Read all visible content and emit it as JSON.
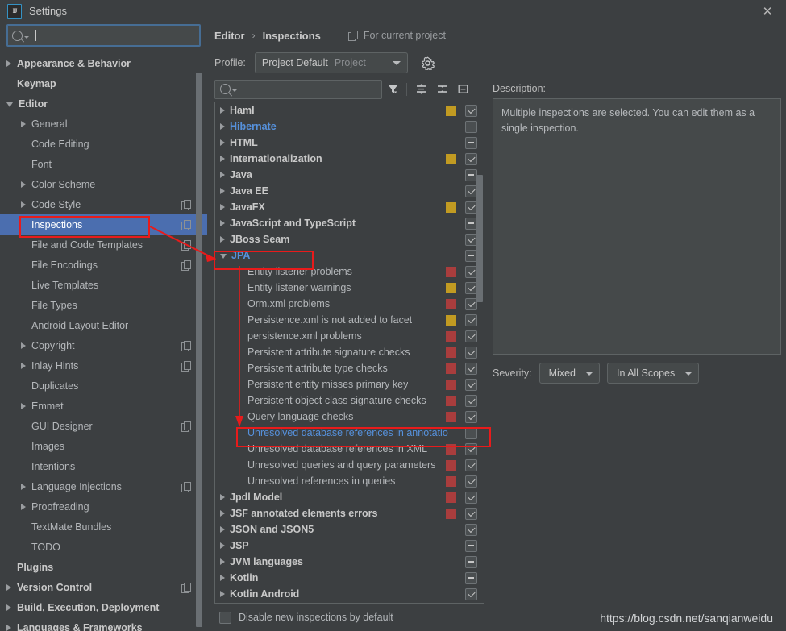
{
  "window": {
    "title": "Settings",
    "app_icon": "intellij-logo-icon",
    "close_icon": "close-icon"
  },
  "sidebar": {
    "search": {
      "value": "",
      "placeholder": "",
      "icon": "search-icon"
    },
    "items": [
      {
        "label": "Appearance & Behavior",
        "arrow": "right",
        "indent": 0,
        "bold": true,
        "copy": false,
        "selected": false
      },
      {
        "label": "Keymap",
        "arrow": "none",
        "indent": 0,
        "bold": true,
        "copy": false,
        "selected": false
      },
      {
        "label": "Editor",
        "arrow": "down",
        "indent": 0,
        "bold": true,
        "copy": false,
        "selected": false
      },
      {
        "label": "General",
        "arrow": "right",
        "indent": 1,
        "bold": false,
        "copy": false,
        "selected": false
      },
      {
        "label": "Code Editing",
        "arrow": "none",
        "indent": 1,
        "bold": false,
        "copy": false,
        "selected": false
      },
      {
        "label": "Font",
        "arrow": "none",
        "indent": 1,
        "bold": false,
        "copy": false,
        "selected": false
      },
      {
        "label": "Color Scheme",
        "arrow": "right",
        "indent": 1,
        "bold": false,
        "copy": false,
        "selected": false
      },
      {
        "label": "Code Style",
        "arrow": "right",
        "indent": 1,
        "bold": false,
        "copy": true,
        "selected": false
      },
      {
        "label": "Inspections",
        "arrow": "none",
        "indent": 1,
        "bold": false,
        "copy": true,
        "selected": true
      },
      {
        "label": "File and Code Templates",
        "arrow": "none",
        "indent": 1,
        "bold": false,
        "copy": true,
        "selected": false
      },
      {
        "label": "File Encodings",
        "arrow": "none",
        "indent": 1,
        "bold": false,
        "copy": true,
        "selected": false
      },
      {
        "label": "Live Templates",
        "arrow": "none",
        "indent": 1,
        "bold": false,
        "copy": false,
        "selected": false
      },
      {
        "label": "File Types",
        "arrow": "none",
        "indent": 1,
        "bold": false,
        "copy": false,
        "selected": false
      },
      {
        "label": "Android Layout Editor",
        "arrow": "none",
        "indent": 1,
        "bold": false,
        "copy": false,
        "selected": false
      },
      {
        "label": "Copyright",
        "arrow": "right",
        "indent": 1,
        "bold": false,
        "copy": true,
        "selected": false
      },
      {
        "label": "Inlay Hints",
        "arrow": "right",
        "indent": 1,
        "bold": false,
        "copy": true,
        "selected": false
      },
      {
        "label": "Duplicates",
        "arrow": "none",
        "indent": 1,
        "bold": false,
        "copy": false,
        "selected": false
      },
      {
        "label": "Emmet",
        "arrow": "right",
        "indent": 1,
        "bold": false,
        "copy": false,
        "selected": false
      },
      {
        "label": "GUI Designer",
        "arrow": "none",
        "indent": 1,
        "bold": false,
        "copy": true,
        "selected": false
      },
      {
        "label": "Images",
        "arrow": "none",
        "indent": 1,
        "bold": false,
        "copy": false,
        "selected": false
      },
      {
        "label": "Intentions",
        "arrow": "none",
        "indent": 1,
        "bold": false,
        "copy": false,
        "selected": false
      },
      {
        "label": "Language Injections",
        "arrow": "right",
        "indent": 1,
        "bold": false,
        "copy": true,
        "selected": false
      },
      {
        "label": "Proofreading",
        "arrow": "right",
        "indent": 1,
        "bold": false,
        "copy": false,
        "selected": false
      },
      {
        "label": "TextMate Bundles",
        "arrow": "none",
        "indent": 1,
        "bold": false,
        "copy": false,
        "selected": false
      },
      {
        "label": "TODO",
        "arrow": "none",
        "indent": 1,
        "bold": false,
        "copy": false,
        "selected": false
      },
      {
        "label": "Plugins",
        "arrow": "none",
        "indent": 0,
        "bold": true,
        "copy": false,
        "selected": false
      },
      {
        "label": "Version Control",
        "arrow": "right",
        "indent": 0,
        "bold": true,
        "copy": true,
        "selected": false
      },
      {
        "label": "Build, Execution, Deployment",
        "arrow": "right",
        "indent": 0,
        "bold": true,
        "copy": false,
        "selected": false
      },
      {
        "label": "Languages & Frameworks",
        "arrow": "right",
        "indent": 0,
        "bold": true,
        "copy": false,
        "selected": false
      }
    ]
  },
  "breadcrumb": {
    "parent": "Editor",
    "separator": "›",
    "current": "Inspections",
    "scope_label": "For current project",
    "scope_icon": "copy-icon"
  },
  "profile": {
    "label": "Profile:",
    "value": "Project Default",
    "scope": "Project",
    "dropdown_icon": "chevron-down-icon",
    "gear_icon": "gear-icon"
  },
  "toolbar": {
    "search": {
      "value": "",
      "placeholder": "",
      "icon": "search-icon"
    },
    "filter_icon": "filter-icon",
    "expand_all_icon": "expand-all-icon",
    "collapse_all_icon": "collapse-all-icon",
    "show_options_icon": "show-options-icon"
  },
  "colors": {
    "selection_blue": "#4b6eaf",
    "link_blue": "#5691dc",
    "severity_error": "#a93d3d",
    "severity_warning": "#c29b22",
    "annotation_red": "#e81b1b",
    "background": "#3c3f41",
    "panel": "#45494a"
  },
  "inspections": [
    {
      "label": "Haml",
      "arrow": "right",
      "level": 1,
      "bold": true,
      "severity": "warning",
      "check": "checked",
      "highlight": false
    },
    {
      "label": "Hibernate",
      "arrow": "right",
      "level": 1,
      "bold": true,
      "severity": "none",
      "check": "empty",
      "highlight": false,
      "link": true
    },
    {
      "label": "HTML",
      "arrow": "right",
      "level": 1,
      "bold": true,
      "severity": "none",
      "check": "partial",
      "highlight": false
    },
    {
      "label": "Internationalization",
      "arrow": "right",
      "level": 1,
      "bold": true,
      "severity": "warning",
      "check": "checked",
      "highlight": false
    },
    {
      "label": "Java",
      "arrow": "right",
      "level": 1,
      "bold": true,
      "severity": "none",
      "check": "partial",
      "highlight": false
    },
    {
      "label": "Java EE",
      "arrow": "right",
      "level": 1,
      "bold": true,
      "severity": "none",
      "check": "checked",
      "highlight": false
    },
    {
      "label": "JavaFX",
      "arrow": "right",
      "level": 1,
      "bold": true,
      "severity": "warning",
      "check": "checked",
      "highlight": false
    },
    {
      "label": "JavaScript and TypeScript",
      "arrow": "right",
      "level": 1,
      "bold": true,
      "severity": "none",
      "check": "partial",
      "highlight": false
    },
    {
      "label": "JBoss Seam",
      "arrow": "right",
      "level": 1,
      "bold": true,
      "severity": "none",
      "check": "checked",
      "highlight": false
    },
    {
      "label": "JPA",
      "arrow": "down",
      "level": 1,
      "bold": true,
      "severity": "none",
      "check": "partial",
      "highlight": false,
      "link": true
    },
    {
      "label": "Entity listener problems",
      "arrow": "none",
      "level": 2,
      "bold": false,
      "severity": "error",
      "check": "checked",
      "highlight": false
    },
    {
      "label": "Entity listener warnings",
      "arrow": "none",
      "level": 2,
      "bold": false,
      "severity": "warning",
      "check": "checked",
      "highlight": false
    },
    {
      "label": "Orm.xml problems",
      "arrow": "none",
      "level": 2,
      "bold": false,
      "severity": "error",
      "check": "checked",
      "highlight": false
    },
    {
      "label": "Persistence.xml is not added to facet",
      "arrow": "none",
      "level": 2,
      "bold": false,
      "severity": "warning",
      "check": "checked",
      "highlight": false
    },
    {
      "label": "persistence.xml problems",
      "arrow": "none",
      "level": 2,
      "bold": false,
      "severity": "error",
      "check": "checked",
      "highlight": false
    },
    {
      "label": "Persistent attribute signature checks",
      "arrow": "none",
      "level": 2,
      "bold": false,
      "severity": "error",
      "check": "checked",
      "highlight": false
    },
    {
      "label": "Persistent attribute type checks",
      "arrow": "none",
      "level": 2,
      "bold": false,
      "severity": "error",
      "check": "checked",
      "highlight": false
    },
    {
      "label": "Persistent entity misses primary key",
      "arrow": "none",
      "level": 2,
      "bold": false,
      "severity": "error",
      "check": "checked",
      "highlight": false
    },
    {
      "label": "Persistent object class signature checks",
      "arrow": "none",
      "level": 2,
      "bold": false,
      "severity": "error",
      "check": "checked",
      "highlight": false
    },
    {
      "label": "Query language checks",
      "arrow": "none",
      "level": 2,
      "bold": false,
      "severity": "error",
      "check": "checked",
      "highlight": false
    },
    {
      "label": "Unresolved database references in annotatio",
      "arrow": "none",
      "level": 2,
      "bold": false,
      "severity": "none",
      "check": "empty",
      "highlight": true,
      "link": true
    },
    {
      "label": "Unresolved database references in XML",
      "arrow": "none",
      "level": 2,
      "bold": false,
      "severity": "error",
      "check": "checked",
      "highlight": false
    },
    {
      "label": "Unresolved queries and query parameters",
      "arrow": "none",
      "level": 2,
      "bold": false,
      "severity": "error",
      "check": "checked",
      "highlight": false
    },
    {
      "label": "Unresolved references in queries",
      "arrow": "none",
      "level": 2,
      "bold": false,
      "severity": "error",
      "check": "checked",
      "highlight": false
    },
    {
      "label": "Jpdl Model",
      "arrow": "right",
      "level": 1,
      "bold": true,
      "severity": "error",
      "check": "checked",
      "highlight": false
    },
    {
      "label": "JSF annotated elements errors",
      "arrow": "right",
      "level": 1,
      "bold": true,
      "severity": "error",
      "check": "checked",
      "highlight": false
    },
    {
      "label": "JSON and JSON5",
      "arrow": "right",
      "level": 1,
      "bold": true,
      "severity": "none",
      "check": "checked",
      "highlight": false
    },
    {
      "label": "JSP",
      "arrow": "right",
      "level": 1,
      "bold": true,
      "severity": "none",
      "check": "partial",
      "highlight": false
    },
    {
      "label": "JVM languages",
      "arrow": "right",
      "level": 1,
      "bold": true,
      "severity": "none",
      "check": "partial",
      "highlight": false
    },
    {
      "label": "Kotlin",
      "arrow": "right",
      "level": 1,
      "bold": true,
      "severity": "none",
      "check": "partial",
      "highlight": false
    },
    {
      "label": "Kotlin Android",
      "arrow": "right",
      "level": 1,
      "bold": true,
      "severity": "none",
      "check": "checked",
      "highlight": false
    }
  ],
  "bottom": {
    "disable_new_label": "Disable new inspections by default",
    "disable_new_checked": false
  },
  "description": {
    "title": "Description:",
    "text": "Multiple inspections are selected. You can edit them as a single inspection."
  },
  "severity": {
    "label": "Severity:",
    "value": "Mixed",
    "scope_value": "In All Scopes",
    "dropdown_icon": "chevron-down-icon"
  },
  "watermark": "https://blog.csdn.net/sanqianweidu"
}
